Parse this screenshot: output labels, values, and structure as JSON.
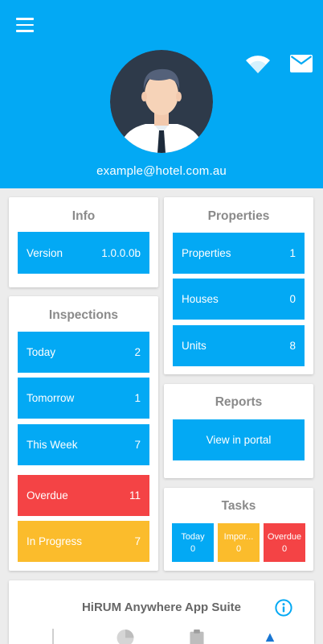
{
  "header": {
    "email": "example@hotel.com.au"
  },
  "info": {
    "title": "Info",
    "version_label": "Version",
    "version_value": "1.0.0.0b"
  },
  "properties": {
    "title": "Properties",
    "items": [
      {
        "label": "Properties",
        "value": "1"
      },
      {
        "label": "Houses",
        "value": "0"
      },
      {
        "label": "Units",
        "value": "8"
      }
    ]
  },
  "inspections": {
    "title": "Inspections",
    "items": [
      {
        "label": "Today",
        "value": "2"
      },
      {
        "label": "Tomorrow",
        "value": "1"
      },
      {
        "label": "This Week",
        "value": "7"
      },
      {
        "label": "Overdue",
        "value": "11"
      },
      {
        "label": "In Progress",
        "value": "7"
      }
    ]
  },
  "reports": {
    "title": "Reports",
    "button_label": "View in portal"
  },
  "tasks": {
    "title": "Tasks",
    "items": [
      {
        "label": "Today",
        "value": "0"
      },
      {
        "label": "Impor...",
        "value": "0"
      },
      {
        "label": "Overdue",
        "value": "0"
      }
    ]
  },
  "suite": {
    "title": "HiRUM Anywhere App Suite"
  },
  "colors": {
    "primary": "#03a9f4",
    "danger": "#f44345",
    "warning": "#fbbc2c"
  },
  "icons": [
    "menu-icon",
    "wifi-icon",
    "mail-icon",
    "avatar",
    "info-icon"
  ]
}
